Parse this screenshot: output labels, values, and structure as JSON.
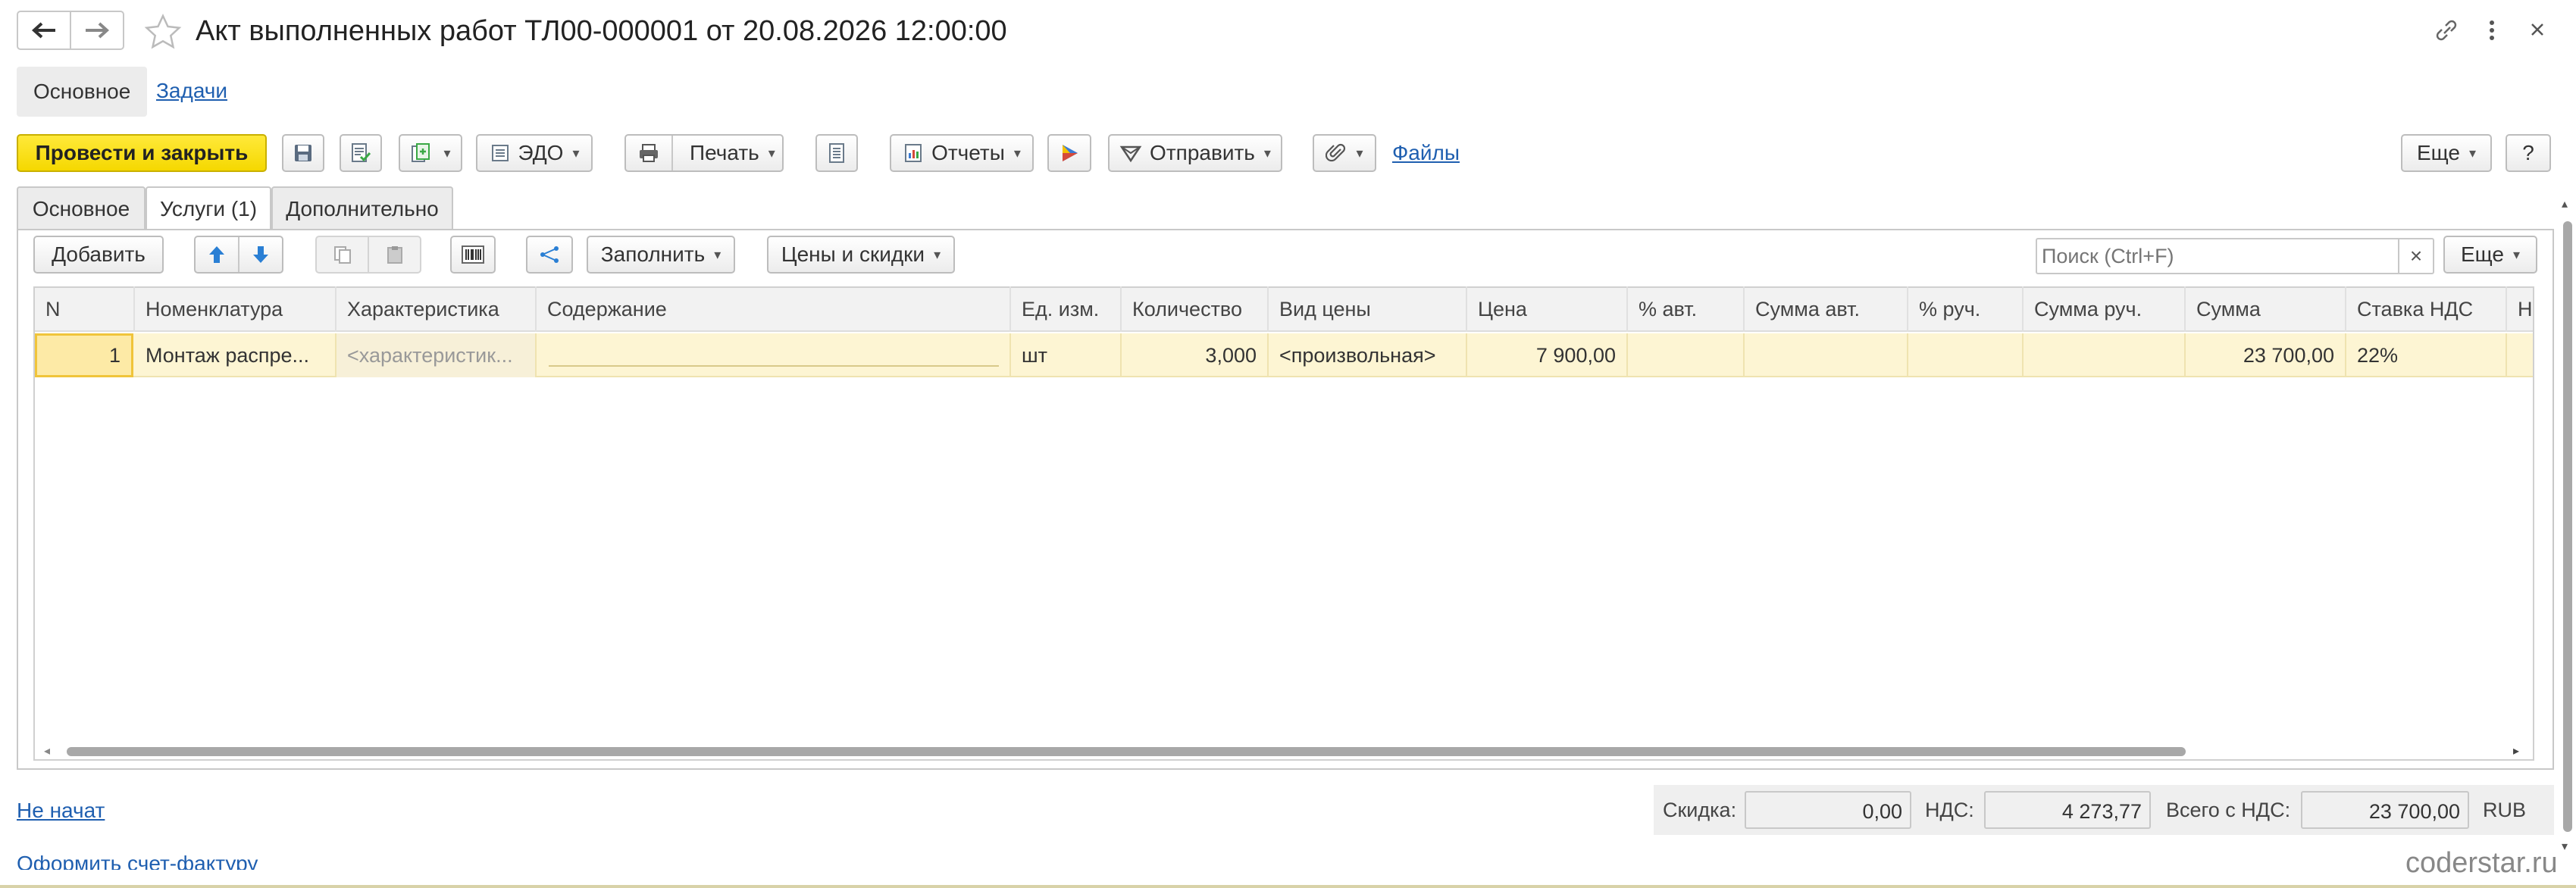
{
  "window": {
    "title": "Акт выполненных работ ТЛ00-000001 от 20.08.2026 12:00:00"
  },
  "top_nav": {
    "main": "Основное",
    "tasks": "Задачи"
  },
  "toolbar": {
    "post_close": "Провести и закрыть",
    "edo": "ЭДО",
    "print": "Печать",
    "reports": "Отчеты",
    "send": "Отправить",
    "files": "Файлы",
    "more": "Еще",
    "help": "?"
  },
  "tabs": {
    "main": "Основное",
    "services": "Услуги (1)",
    "additional": "Дополнительно"
  },
  "table_toolbar": {
    "add": "Добавить",
    "fill": "Заполнить",
    "prices": "Цены и скидки",
    "more": "Еще",
    "search_placeholder": "Поиск (Ctrl+F)",
    "search_clear": "×"
  },
  "table": {
    "columns": [
      "N",
      "Номенклатура",
      "Характеристика",
      "Содержание",
      "Ед. изм.",
      "Количество",
      "Вид цены",
      "Цена",
      "% авт.",
      "Сумма авт.",
      "% руч.",
      "Сумма руч.",
      "Сумма",
      "Ставка НДС",
      "Н"
    ],
    "rows": [
      {
        "n": "1",
        "item": "Монтаж распре...",
        "characteristic": "<характеристик...",
        "content": "",
        "unit": "шт",
        "quantity": "3,000",
        "price_type": "<произвольная>",
        "price": "7 900,00",
        "pct_auto": "",
        "sum_auto": "",
        "pct_manual": "",
        "sum_manual": "",
        "sum": "23 700,00",
        "vat_rate": "22%"
      }
    ]
  },
  "footer": {
    "status_link": "Не начат",
    "invoice_link": "Оформить счет-фактуру",
    "discount_label": "Скидка:",
    "discount_value": "0,00",
    "vat_label": "НДС:",
    "vat_value": "4 273,77",
    "total_label": "Всего с НДС:",
    "total_value": "23 700,00",
    "currency": "RUB"
  },
  "watermark": "coderstar.ru",
  "colors": {
    "primary_button": "#f5d800",
    "selected_row": "#fdf5d3",
    "link": "#1f5fb0",
    "arrow_icon": "#2a7fd4"
  }
}
